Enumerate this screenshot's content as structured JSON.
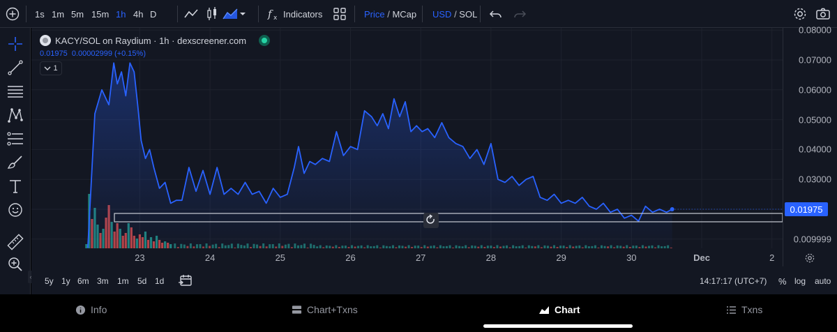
{
  "toolbar": {
    "timeframes": [
      "1s",
      "1m",
      "5m",
      "15m",
      "1h",
      "4h",
      "D"
    ],
    "active_timeframe": "1h",
    "indicators_label": "Indicators",
    "price_label": "Price",
    "price_slash": " / ",
    "mcap_label": "MCap",
    "usd_label": "USD",
    "sol_label": "SOL",
    "icons": [
      "plus-circle-icon",
      "line-chart-icon",
      "candles-icon",
      "area-chart-icon",
      "fx-icon",
      "grid-icon",
      "undo-icon",
      "redo-icon",
      "gear-icon",
      "camera-icon"
    ]
  },
  "left_tools": [
    "crosshair-icon",
    "trendline-icon",
    "horizontal-lines-icon",
    "pattern-icon",
    "fib-icon",
    "brush-icon",
    "text-icon",
    "emoji-icon",
    "ruler-icon",
    "zoom-in-icon"
  ],
  "legend": {
    "title": "KACY/SOL on Raydium · 1h · dexscreener.com",
    "values": "0.01975  0.00002999 (+0.15%)",
    "collapse_label": "1"
  },
  "colors": {
    "background": "#131722",
    "line": "#2962ff",
    "up": "#26a69a",
    "down": "#ef5350",
    "accent": "#2962ff"
  },
  "chart_data": {
    "type": "area",
    "title": "KACY/SOL on Raydium",
    "x_ticks": [
      "23",
      "24",
      "25",
      "26",
      "27",
      "28",
      "29",
      "30",
      "Dec",
      "2"
    ],
    "y_ticks": [
      "0.08000",
      "0.07000",
      "0.06000",
      "0.05000",
      "0.04000",
      "0.03000",
      "0.009999"
    ],
    "ylim": [
      0.005,
      0.081
    ],
    "last_price": "0.01975",
    "series": [
      {
        "name": "Price",
        "x": [
          22.26,
          22.36,
          22.46,
          22.56,
          22.63,
          22.68,
          22.74,
          22.8,
          22.86,
          22.92,
          22.97,
          23.02,
          23.08,
          23.14,
          23.2,
          23.28,
          23.36,
          23.44,
          23.52,
          23.6,
          23.7,
          23.8,
          23.9,
          24.0,
          24.1,
          24.2,
          24.3,
          24.4,
          24.5,
          24.6,
          24.7,
          24.8,
          24.9,
          25.0,
          25.1,
          25.2,
          25.26,
          25.34,
          25.42,
          25.5,
          25.6,
          25.7,
          25.8,
          25.9,
          26.0,
          26.1,
          26.2,
          26.3,
          26.38,
          26.46,
          26.54,
          26.62,
          26.7,
          26.78,
          26.86,
          26.94,
          27.02,
          27.1,
          27.2,
          27.3,
          27.4,
          27.5,
          27.6,
          27.7,
          27.8,
          27.9,
          28.0,
          28.1,
          28.2,
          28.3,
          28.4,
          28.5,
          28.6,
          28.7,
          28.8,
          28.9,
          29.0,
          29.1,
          29.2,
          29.3,
          29.4,
          29.5,
          29.6,
          29.7,
          29.8,
          29.9,
          30.0,
          30.1,
          30.2,
          30.3,
          30.4,
          30.5,
          30.58
        ],
        "values": [
          0.007,
          0.052,
          0.06,
          0.055,
          0.069,
          0.062,
          0.066,
          0.058,
          0.069,
          0.066,
          0.055,
          0.043,
          0.037,
          0.04,
          0.034,
          0.027,
          0.029,
          0.022,
          0.023,
          0.023,
          0.034,
          0.026,
          0.033,
          0.025,
          0.034,
          0.025,
          0.027,
          0.025,
          0.029,
          0.025,
          0.026,
          0.022,
          0.027,
          0.024,
          0.025,
          0.034,
          0.041,
          0.032,
          0.036,
          0.035,
          0.037,
          0.036,
          0.046,
          0.038,
          0.041,
          0.04,
          0.053,
          0.051,
          0.048,
          0.052,
          0.047,
          0.057,
          0.051,
          0.056,
          0.046,
          0.048,
          0.046,
          0.047,
          0.044,
          0.049,
          0.044,
          0.042,
          0.041,
          0.037,
          0.04,
          0.035,
          0.042,
          0.03,
          0.029,
          0.031,
          0.028,
          0.03,
          0.031,
          0.024,
          0.023,
          0.025,
          0.022,
          0.023,
          0.022,
          0.024,
          0.021,
          0.02,
          0.022,
          0.019,
          0.02,
          0.017,
          0.018,
          0.016,
          0.021,
          0.019,
          0.02,
          0.019,
          0.02
        ]
      }
    ],
    "volume": {
      "x": [
        22.24,
        22.28,
        22.32,
        22.36,
        22.4,
        22.44,
        22.48,
        22.52,
        22.56,
        22.6,
        22.64,
        22.68,
        22.72,
        22.76,
        22.8,
        22.84,
        22.88,
        22.92,
        22.96,
        23.0,
        23.04,
        23.08,
        23.12,
        23.16,
        23.2,
        23.24,
        23.28,
        23.32,
        23.36,
        23.4,
        23.44
      ],
      "values": [
        6,
        78,
        42,
        58,
        34,
        22,
        28,
        44,
        62,
        38,
        24,
        36,
        28,
        18,
        22,
        36,
        30,
        18,
        14,
        20,
        16,
        24,
        12,
        16,
        10,
        18,
        12,
        8,
        10,
        8,
        6
      ],
      "up": [
        true,
        true,
        false,
        true,
        true,
        false,
        true,
        false,
        false,
        true,
        false,
        false,
        true,
        false,
        false,
        true,
        false,
        false,
        true,
        false,
        false,
        true,
        false,
        true,
        false,
        true,
        false,
        false,
        true,
        false,
        true
      ]
    },
    "grid": true,
    "legend_position": "top-left"
  },
  "xaxis_settings_icon": "gear-icon",
  "range_bar": {
    "ranges": [
      "5y",
      "1y",
      "6m",
      "3m",
      "1m",
      "5d",
      "1d"
    ],
    "calendar_icon": "calendar-range-icon",
    "clock": "14:17:17 (UTC+7)",
    "percent_label": "%",
    "log_label": "log",
    "auto_label": "auto"
  },
  "bottom_nav": [
    {
      "label": "Info",
      "icon": "info-icon",
      "active": false
    },
    {
      "label": "Chart+Txns",
      "icon": "split-icon",
      "active": false
    },
    {
      "label": "Chart",
      "icon": "chart-icon",
      "active": true
    },
    {
      "label": "Txns",
      "icon": "list-icon",
      "active": false
    }
  ]
}
